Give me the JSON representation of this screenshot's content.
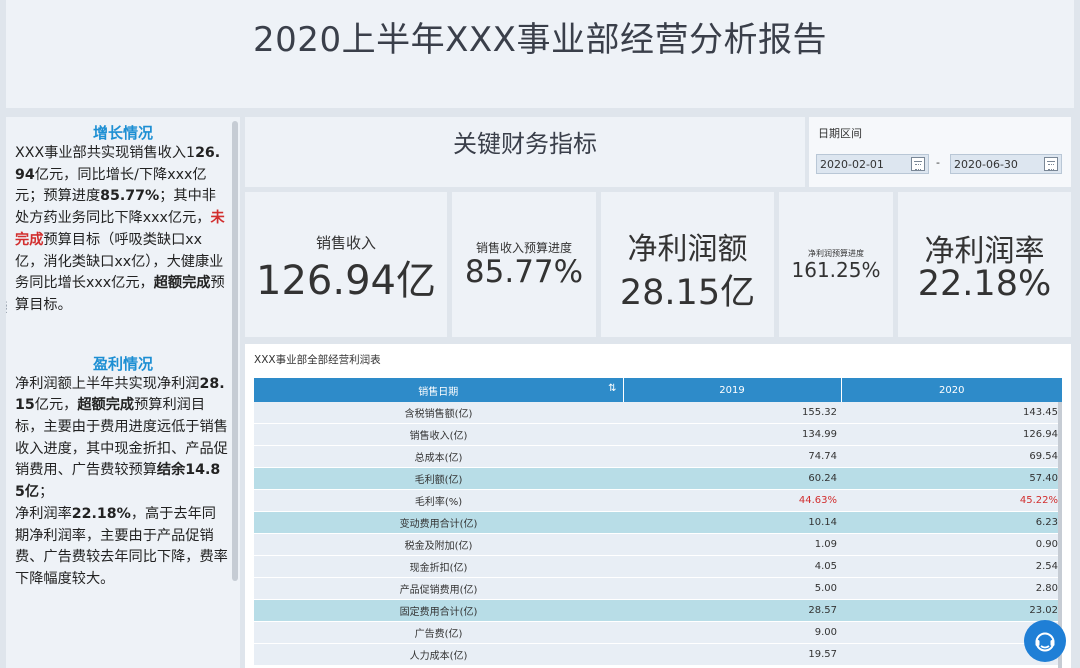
{
  "header": {
    "title": "2020上半年XXX事业部经营分析报告"
  },
  "growth": {
    "title": "增长情况",
    "p1": "XXX事业部共实现销售收入1",
    "p2": "26.94",
    "p3": "亿元，同比增长/下降xxx亿元；预算进度",
    "p4": "85.77%",
    "p5": "；其中非处方药业务同比下降xxx亿元，",
    "p6": "未完成",
    "p7": "预算目标（呼吸类缺口xx亿，消化类缺口xx亿），大健康业务同比增长xxx亿元，",
    "p8": "超额完成",
    "p9": "预算目标。"
  },
  "profit": {
    "title": "盈利情况",
    "p1": "净利润额上半年共实现净利润",
    "p2": "28.15",
    "p3": "亿元，",
    "p4": "超额完成",
    "p5": "预算利润目标，主要由于费用进度远低于销售收入进度，其中现金折扣、产品促销费用、广告费较预算",
    "p6": "结余14.85亿",
    "p7": "；",
    "p8": "净利润率",
    "p9": "22.18%",
    "p10": "，高于去年同期净利润率，主要由于产品促销费、广告费较去年同比下降，费率下降幅度较大。"
  },
  "key_financials": {
    "title": "关键财务指标"
  },
  "date_range": {
    "label": "日期区间",
    "start": "2020-02-01",
    "separator": "-",
    "end": "2020-06-30"
  },
  "kpis": {
    "sales": {
      "label": "销售收入",
      "value": "126.94亿"
    },
    "sales_progress": {
      "label": "销售收入预算进度",
      "value": "85.77%"
    },
    "net_profit": {
      "label": "净利润额",
      "value": "28.15亿"
    },
    "net_profit_progress": {
      "label": "净利润预算进度",
      "value": "161.25%"
    },
    "net_margin": {
      "label": "净利润率",
      "value": "22.18%"
    }
  },
  "table": {
    "title": "XXX事业部全部经营利润表",
    "headers": [
      "销售日期",
      "2019",
      "2020"
    ],
    "rows": [
      [
        "含税销售额(亿)",
        "155.32",
        "143.45"
      ],
      [
        "销售收入(亿)",
        "134.99",
        "126.94"
      ],
      [
        "总成本(亿)",
        "74.74",
        "69.54"
      ],
      [
        "毛利额(亿)",
        "60.24",
        "57.40"
      ],
      [
        "毛利率(%)",
        "44.63%",
        "45.22%"
      ],
      [
        "变动费用合计(亿)",
        "10.14",
        "6.23"
      ],
      [
        "税金及附加(亿)",
        "1.09",
        "0.90"
      ],
      [
        "现金折扣(亿)",
        "4.05",
        "2.54"
      ],
      [
        "产品促销费用(亿)",
        "5.00",
        "2.80"
      ],
      [
        "固定费用合计(亿)",
        "28.57",
        "23.02"
      ],
      [
        "广告费(亿)",
        "9.00",
        ""
      ],
      [
        "人力成本(亿)",
        "19.57",
        ""
      ]
    ],
    "highlight_color": "#b8dde7",
    "negative_color": "#d22e2e"
  },
  "icons": {
    "sort": "sort-icon",
    "calendar": "calendar-icon",
    "help": "headset-icon"
  }
}
